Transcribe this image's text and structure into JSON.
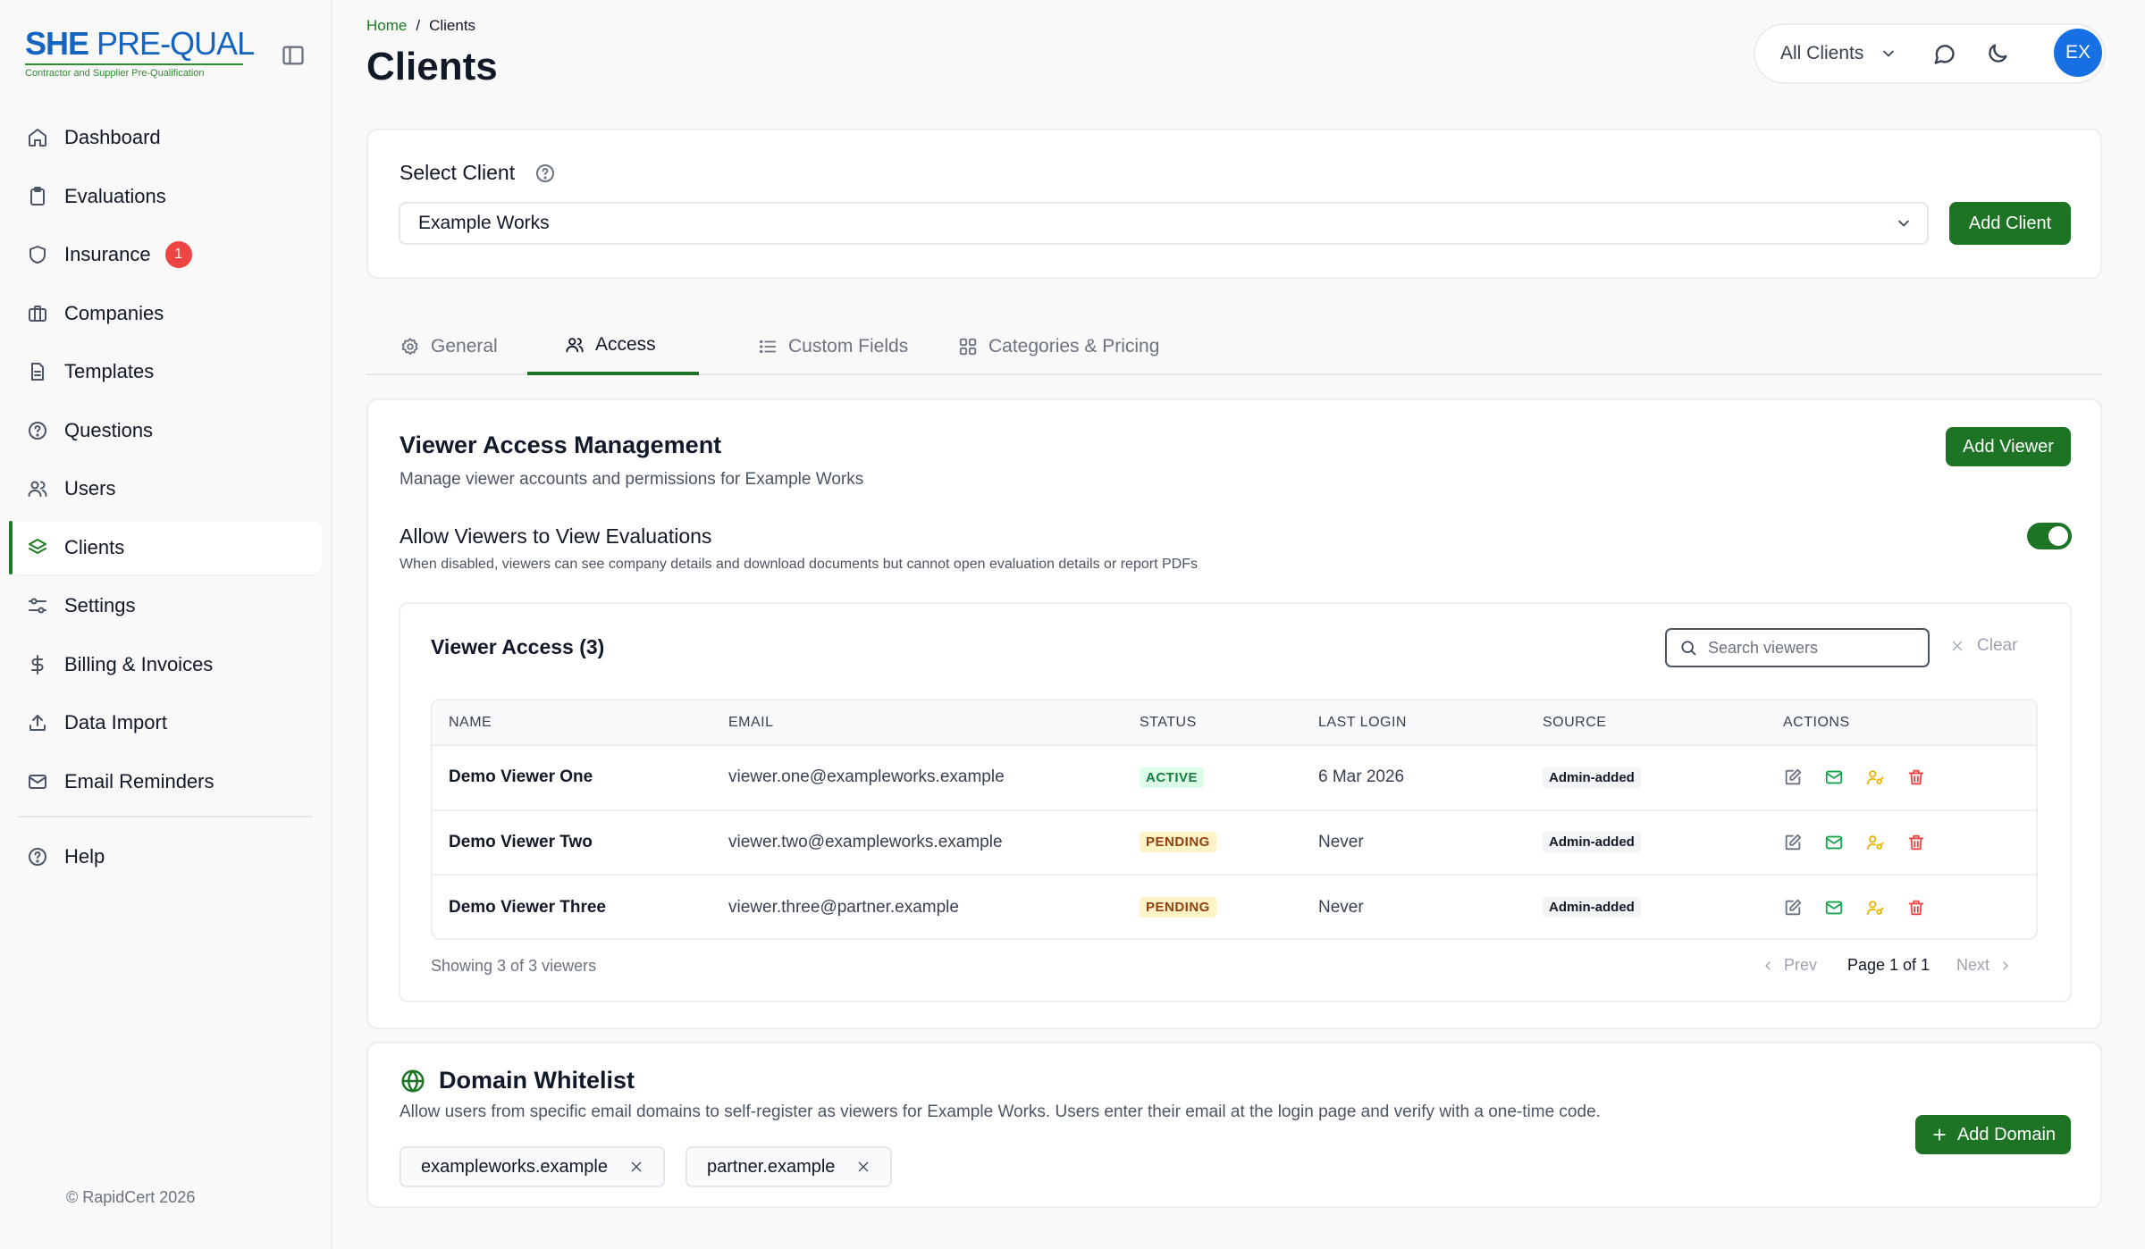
{
  "brand": {
    "logo_bold": "SHE",
    "logo_rest": "PRE-QUAL",
    "logo_sub": "Contractor and Supplier Pre-Qualification",
    "accent": "#1c7424",
    "blue": "#1565c0"
  },
  "sidebar": {
    "items": [
      {
        "label": "Dashboard",
        "icon": "home-icon"
      },
      {
        "label": "Evaluations",
        "icon": "clipboard-icon"
      },
      {
        "label": "Insurance",
        "icon": "shield-icon",
        "badge": "1"
      },
      {
        "label": "Companies",
        "icon": "briefcase-icon"
      },
      {
        "label": "Templates",
        "icon": "file-icon"
      },
      {
        "label": "Questions",
        "icon": "help-circle-icon"
      },
      {
        "label": "Users",
        "icon": "users-icon"
      },
      {
        "label": "Clients",
        "icon": "layers-icon",
        "active": true
      },
      {
        "label": "Settings",
        "icon": "sliders-icon"
      },
      {
        "label": "Billing & Invoices",
        "icon": "dollar-icon"
      },
      {
        "label": "Data Import",
        "icon": "upload-icon"
      },
      {
        "label": "Email Reminders",
        "icon": "mail-icon"
      }
    ],
    "help": "Help",
    "footer": "© RapidCert 2026"
  },
  "header": {
    "breadcrumb": [
      "Home",
      "Clients"
    ],
    "breadcrumb_sep": "/",
    "title": "Clients",
    "client_filter": "All Clients",
    "avatar": "EX"
  },
  "select_client": {
    "label": "Select Client",
    "value": "Example Works",
    "add_button": "Add Client"
  },
  "tabs": [
    {
      "label": "General",
      "icon": "gear-icon"
    },
    {
      "label": "Access",
      "icon": "users-icon",
      "active": true
    },
    {
      "label": "Custom Fields",
      "icon": "list-icon"
    },
    {
      "label": "Categories & Pricing",
      "icon": "grid-icon"
    }
  ],
  "viewer_access": {
    "title": "Viewer Access Management",
    "subtitle": "Manage viewer accounts and permissions for Example Works",
    "add_button": "Add Viewer",
    "toggle_label": "Allow Viewers to View Evaluations",
    "toggle_desc": "When disabled, viewers can see company details and download documents but cannot open evaluation details or report PDFs",
    "toggle_on": true,
    "list_title": "Viewer Access (3)",
    "search_placeholder": "Search viewers",
    "clear_label": "Clear",
    "columns": [
      "NAME",
      "EMAIL",
      "STATUS",
      "LAST LOGIN",
      "SOURCE",
      "ACTIONS"
    ],
    "rows": [
      {
        "name": "Demo Viewer One",
        "email": "viewer.one@exampleworks.example",
        "status": "ACTIVE",
        "last_login": "6 Mar 2026",
        "source": "Admin-added"
      },
      {
        "name": "Demo Viewer Two",
        "email": "viewer.two@exampleworks.example",
        "status": "PENDING",
        "last_login": "Never",
        "source": "Admin-added"
      },
      {
        "name": "Demo Viewer Three",
        "email": "viewer.three@partner.example",
        "status": "PENDING",
        "last_login": "Never",
        "source": "Admin-added"
      }
    ],
    "showing": "Showing 3 of 3 viewers",
    "prev": "Prev",
    "page": "Page 1 of 1",
    "next": "Next"
  },
  "domain_whitelist": {
    "title": "Domain Whitelist",
    "desc": "Allow users from specific email domains to self-register as viewers for Example Works. Users enter their email at the login page and verify with a one-time code.",
    "add_button": "Add Domain",
    "domains": [
      "exampleworks.example",
      "partner.example"
    ]
  }
}
